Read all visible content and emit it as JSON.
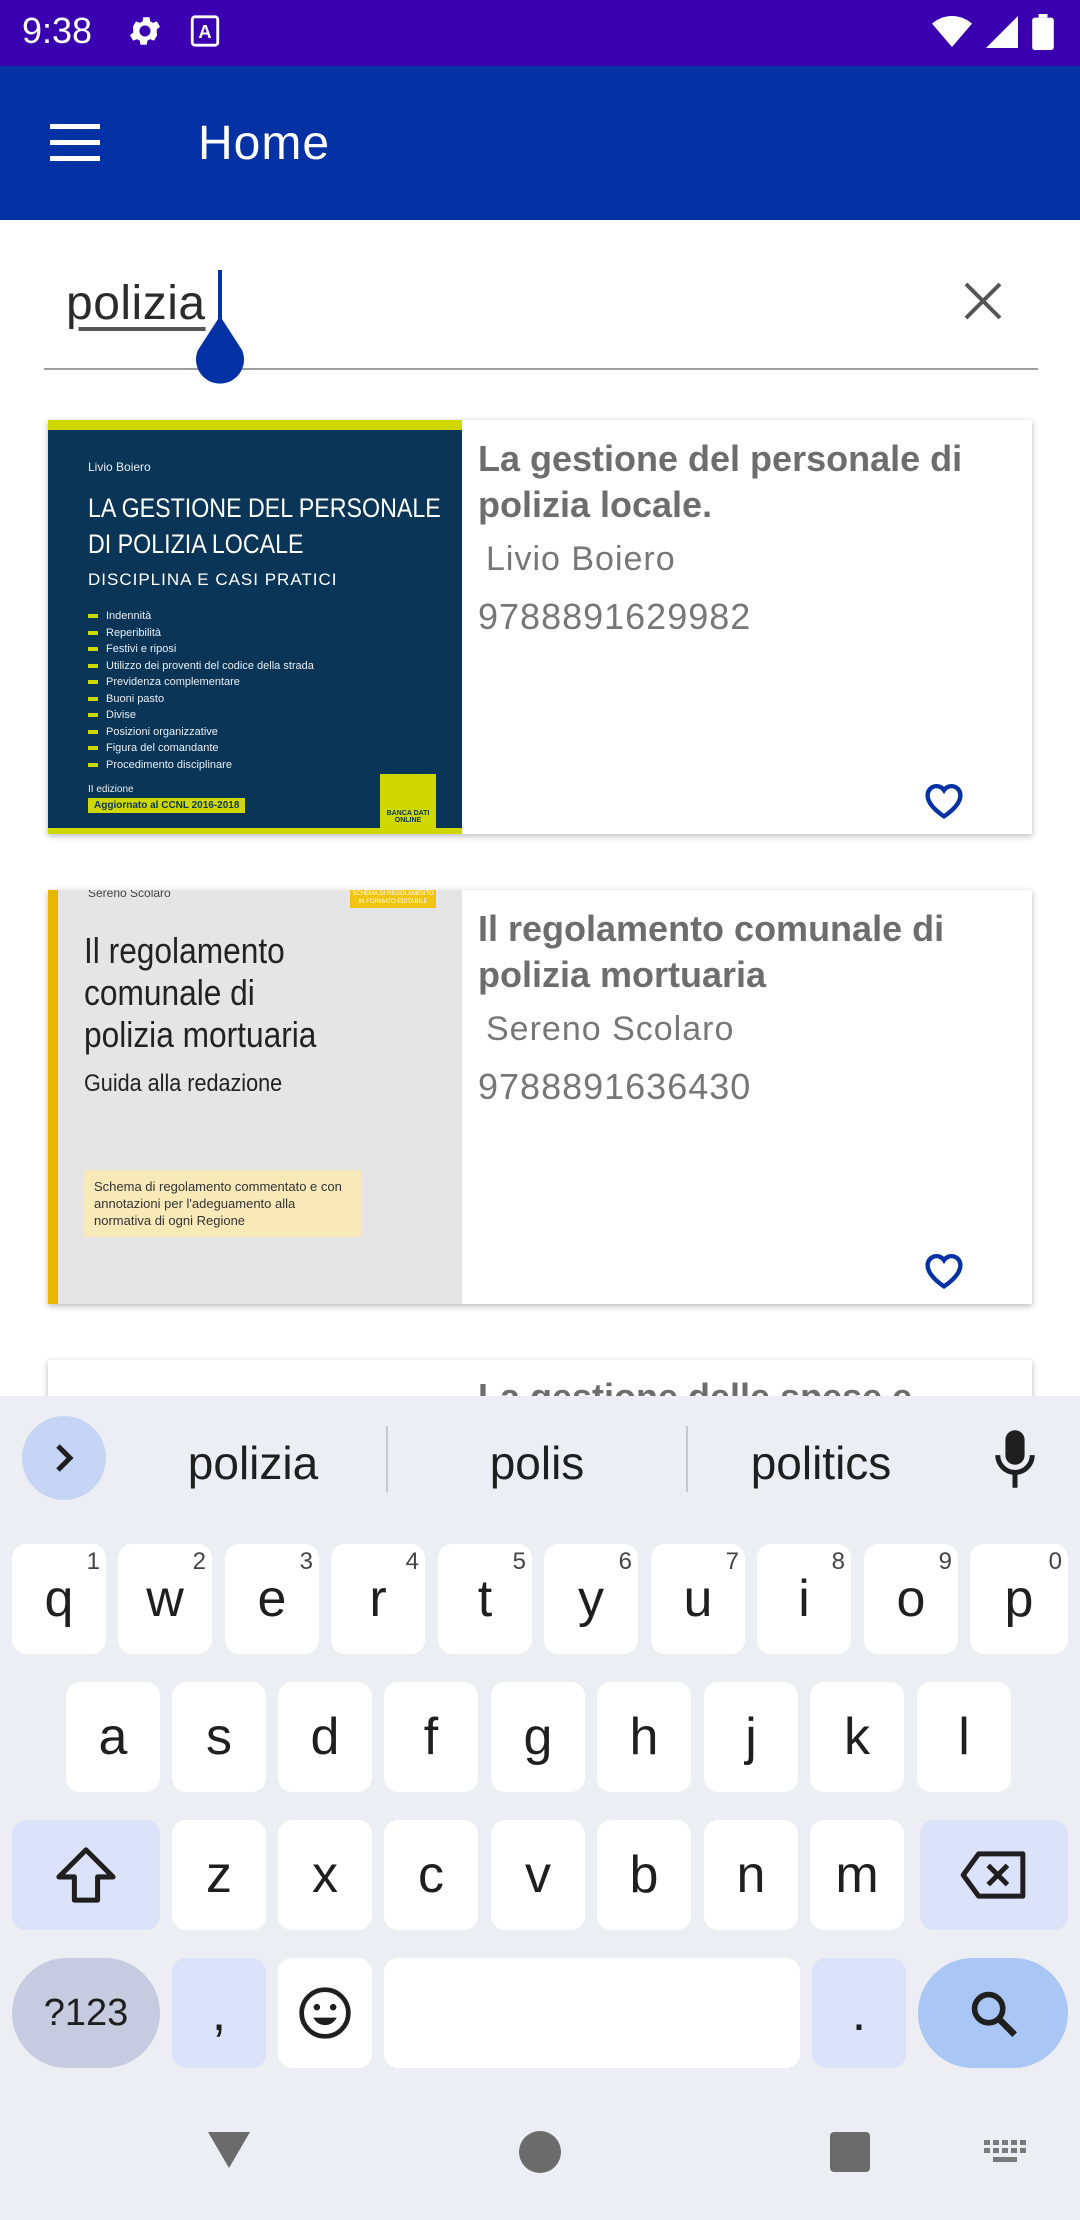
{
  "status_bar": {
    "time": "9:38"
  },
  "app_bar": {
    "title": "Home"
  },
  "search": {
    "value": "polizia"
  },
  "results": [
    {
      "title": "La gestione del personale di polizia locale.",
      "author": "Livio Boiero",
      "isbn": "9788891629982",
      "cover": {
        "author": "Livio Boiero",
        "title_line1": "LA GESTIONE DEL PERSONALE",
        "title_line2": "DI POLIZIA LOCALE",
        "subtitle": "DISCIPLINA E CASI PRATICI",
        "items": [
          "Indennità",
          "Reperibilità",
          "Festivi e riposi",
          "Utilizzo dei proventi del codice della strada",
          "Previdenza complementare",
          "Buoni pasto",
          "Divise",
          "Posizioni organizzative",
          "Figura del comandante",
          "Procedimento disciplinare"
        ],
        "edition": "II edizione",
        "badge": "Aggiornato al CCNL 2016-2018",
        "db_label": "BANCA DATI ONLINE"
      }
    },
    {
      "title": "Il regolamento comunale di polizia mortuaria",
      "author": "Sereno Scolaro",
      "isbn": "9788891636430",
      "cover": {
        "author": "Sereno Scolaro",
        "tag": "SCHEMA DI REGOLAMENTO IN FORMATO EDITABILE",
        "title_line1": "Il regolamento",
        "title_line2": "comunale di",
        "title_line3": "polizia mortuaria",
        "subtitle": "Guida alla redazione",
        "box": "Schema di regolamento commentato e con annotazioni per l'adeguamento alla normativa di ogni Regione"
      }
    },
    {
      "title": "La gestione delle spese e"
    }
  ],
  "keyboard": {
    "suggestions": [
      "polizia",
      "polis",
      "politics"
    ],
    "row1": [
      {
        "k": "q",
        "h": "1"
      },
      {
        "k": "w",
        "h": "2"
      },
      {
        "k": "e",
        "h": "3"
      },
      {
        "k": "r",
        "h": "4"
      },
      {
        "k": "t",
        "h": "5"
      },
      {
        "k": "y",
        "h": "6"
      },
      {
        "k": "u",
        "h": "7"
      },
      {
        "k": "i",
        "h": "8"
      },
      {
        "k": "o",
        "h": "9"
      },
      {
        "k": "p",
        "h": "0"
      }
    ],
    "row2": [
      "a",
      "s",
      "d",
      "f",
      "g",
      "h",
      "j",
      "k",
      "l"
    ],
    "row3": [
      "z",
      "x",
      "c",
      "v",
      "b",
      "n",
      "m"
    ],
    "sym_label": "?123",
    "comma": ",",
    "period": "."
  }
}
